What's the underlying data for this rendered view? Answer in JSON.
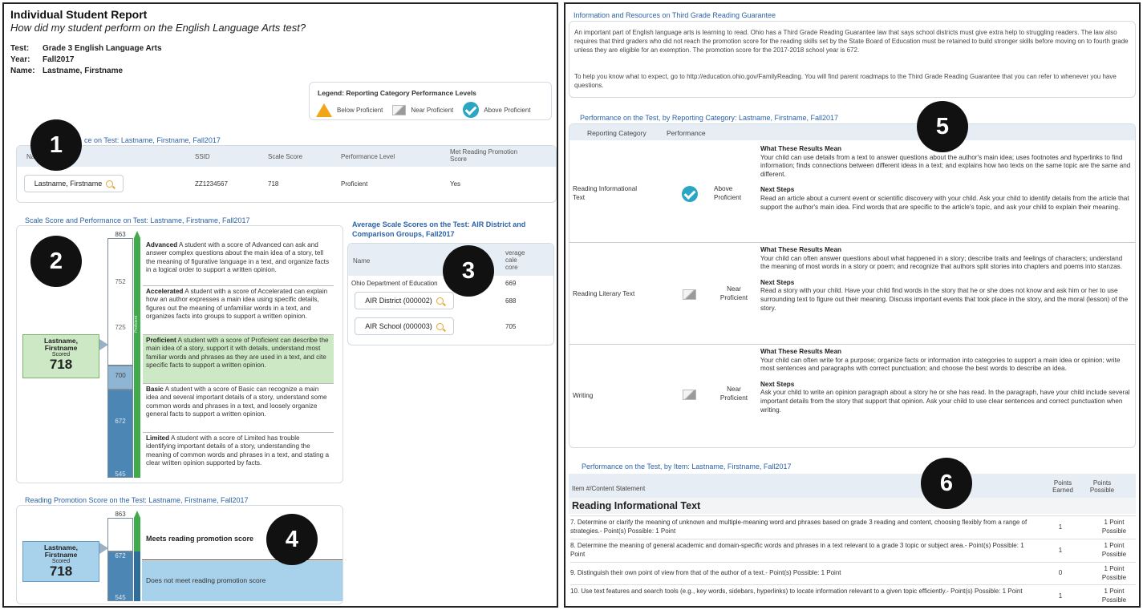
{
  "report": {
    "title": "Individual Student Report",
    "subtitle": "How did my student perform on the English Language Arts test?",
    "test_label": "Test:",
    "test_value": "Grade 3 English Language Arts",
    "year_label": "Year:",
    "year_value": "Fall2017",
    "name_label": "Name:",
    "name_value": "Lastname, Firstname"
  },
  "legend": {
    "title": "Legend: Reporting Category Performance Levels",
    "below": "Below Proficient",
    "near": "Near Proficient",
    "above": "Above Proficient"
  },
  "badges": [
    "1",
    "2",
    "3",
    "4",
    "5",
    "6"
  ],
  "perf_on_test": {
    "title": "ce on Test: Lastname, Firstname, Fall2017",
    "col_name": "Na",
    "col_ssid": "SSID",
    "col_scale": "Scale Score",
    "col_level": "Performance Level",
    "col_promo": "Met Reading Promotion Score",
    "row": {
      "name": "Lastname, Firstname",
      "ssid": "ZZ1234567",
      "scale": "718",
      "level": "Proficient",
      "promo": "Yes"
    }
  },
  "scale_section": {
    "title": "Scale Score and Performance on Test: Lastname, Firstname, Fall2017",
    "ticks": [
      "863",
      "752",
      "725",
      "700",
      "672",
      "545"
    ],
    "bar_label": "Proficient",
    "student": {
      "name": "Lastname, Firstname",
      "scored": "Scored",
      "score": "718"
    },
    "levels": [
      {
        "name": "Advanced",
        "text": " A student with a score of Advanced can ask and answer complex questions about the main idea of a story, tell the meaning of figurative language in a text, and organize facts in a logical order to support a written opinion."
      },
      {
        "name": "Accelerated",
        "text": " A student with a score of Accelerated can explain how an author expresses a main idea using specific details, figures out the meaning of unfamiliar words in a text, and organizes facts into groups to support a written opinion."
      },
      {
        "name": "Proficient",
        "text": " A student with a score of Proficient can describe the main idea of a story, support it with details, understand most familiar words and phrases as they are used in a text, and cite specific facts to support a written opinion."
      },
      {
        "name": "Basic",
        "text": " A student with a score of Basic can recognize a main idea and several important details of a story, understand some common words and phrases in a text, and loosely organize general facts to support a written opinion."
      },
      {
        "name": "Limited",
        "text": " A student with a score of Limited has trouble identifying important details of a story, understanding the meaning of common words and phrases in a text, and stating a clear written opinion supported by facts."
      }
    ]
  },
  "avg_section": {
    "title": "Average Scale Scores on the Test: AIR District and Comparison Groups, Fall2017",
    "col_name": "Name",
    "col_avg": "verage cale core",
    "rows": [
      {
        "name": "Ohio Department of Education",
        "score": "669"
      },
      {
        "name": "AIR District (000002)",
        "score": "688"
      },
      {
        "name": "AIR School (000003)",
        "score": "705"
      }
    ]
  },
  "promo_section": {
    "title": "Reading Promotion Score on the Test: Lastname, Firstname, Fall2017",
    "ticks": [
      "863",
      "672",
      "545"
    ],
    "meets": "Meets reading promotion score",
    "not_meets": "Does not meet reading promotion score",
    "student": {
      "name": "Lastname, Firstname",
      "scored": "Scored",
      "score": "718"
    }
  },
  "info": {
    "title": "Information and Resources on Third Grade Reading Guarantee",
    "p1": "An important part of English language arts is learning to read. Ohio has a Third Grade Reading Guarantee law that says school districts must give extra help to struggling readers. The law also requires that third graders who did not reach the promotion score for the reading skills set by the State Board of Education must be retained to build stronger skills before moving on to fourth grade unless they are eligible for an exemption. The promotion score for the 2017-2018 school year is 672.",
    "p2": "To help you know what to expect, go to http://education.ohio.gov/FamilyReading. You will find parent roadmaps to the Third Grade Reading Guarantee that you can refer to whenever you have questions."
  },
  "category_section": {
    "title": "Performance on the Test, by Reporting Category: Lastname, Firstname, Fall2017",
    "col_cat": "Reporting Category",
    "col_perf": "Performance",
    "mean_label": "What These Results Mean",
    "next_label": "Next Steps",
    "rows": [
      {
        "cat": "Reading Informational Text",
        "perf": "Above Proficient",
        "icon": "check",
        "mean": "Your child can use details from a text to answer questions about the author's main idea; uses footnotes and hyperlinks to find information; finds connections between different ideas in a text; and explains how two texts on the same topic are the same and different.",
        "next": "Read an article about a current event or scientific discovery with your child. Ask your child to identify details from the article that support the author's main idea. Find words that are specific to the article's topic, and ask your child to explain their meaning."
      },
      {
        "cat": "Reading Literary Text",
        "perf": "Near Proficient",
        "icon": "grey",
        "mean": "Your child can often answer questions about what happened in a story; describe traits and feelings of characters; understand the meaning of most words in a story or poem; and recognize that authors split stories into chapters and poems into stanzas.",
        "next": "Read a story with your child. Have your child find words in the story that he or she does not know and ask him or her to use surrounding text to figure out their meaning. Discuss important events that took place in the story, and the moral (lesson) of the story."
      },
      {
        "cat": "Writing",
        "perf": "Near Proficient",
        "icon": "grey",
        "mean": "Your child can often write for a purpose; organize facts or information into categories to support a main idea or opinion; write most sentences and paragraphs with correct punctuation; and choose the best words to describe an idea.",
        "next": "Ask your child to write an opinion paragraph about a story he or she has read. In the paragraph, have your child include several important details from the story that support that opinion. Ask your child to use clear sentences and correct punctuation when writing."
      }
    ]
  },
  "item_section": {
    "title": "Performance on the Test, by Item: Lastname, Firstname, Fall2017",
    "col_item": "Item #/Content Statement",
    "col_earned": "Points Earned",
    "col_possible": "Points Possible",
    "group": "Reading Informational Text",
    "rows": [
      {
        "text": "7. Determine or clarify the meaning of unknown and multiple-meaning word and phrases based on grade 3 reading and content, choosing flexibly from a range of strategies.- Point(s) Possible: 1 Point",
        "earned": "1",
        "possible": "1 Point Possible"
      },
      {
        "text": "8. Determine the meaning of general academic and domain-specific words and phrases in a text relevant to a grade 3 topic or subject area.- Point(s) Possible: 1 Point",
        "earned": "1",
        "possible": "1 Point Possible"
      },
      {
        "text": "9. Distinguish their own point of view from that of the author of a text.- Point(s) Possible: 1 Point",
        "earned": "0",
        "possible": "1 Point Possible"
      },
      {
        "text": "10. Use text features and search tools (e.g., key words, sidebars, hyperlinks) to locate information relevant to a given topic efficiently.- Point(s) Possible: 1 Point",
        "earned": "1",
        "possible": "1 Point Possible"
      }
    ]
  }
}
